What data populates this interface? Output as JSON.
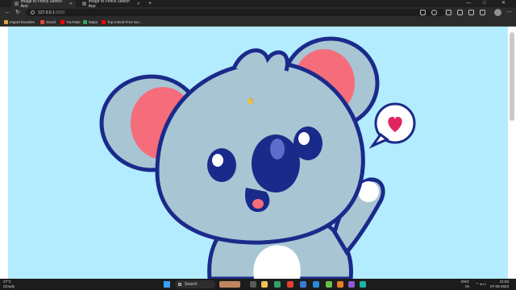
{
  "browser": {
    "tabs": [
      {
        "label": "Image to Pencil Sketch App",
        "active": true
      },
      {
        "label": "Image to Pencil Sketch App",
        "active": false
      }
    ],
    "new_tab_label": "+",
    "window_controls": {
      "minimize": "—",
      "maximize": "□",
      "close": "✕"
    },
    "nav": {
      "back": "←",
      "reload": "↻",
      "forward": "→"
    },
    "address": {
      "host": "127.0.0.1",
      "port": ":5000"
    },
    "bookmarks": [
      {
        "label": "Import favorites",
        "color": "#d9a93a"
      },
      {
        "label": "Gmail",
        "color": "#e8453c"
      },
      {
        "label": "YouTube",
        "color": "#ff0000"
      },
      {
        "label": "Maps",
        "color": "#34a853"
      },
      {
        "label": "Top 5 Best Free Scr...",
        "color": "#ff0000"
      }
    ]
  },
  "page": {
    "background_color": "#b3ecff",
    "image_alt": "koala-cartoon-waving"
  },
  "taskbar": {
    "weather": {
      "temp": "27°C",
      "condition": "Cloudy"
    },
    "search_label": "Search",
    "tray": {
      "language": "ENG",
      "region": "IN",
      "time": "21:53",
      "date": "07-09-2023"
    }
  }
}
